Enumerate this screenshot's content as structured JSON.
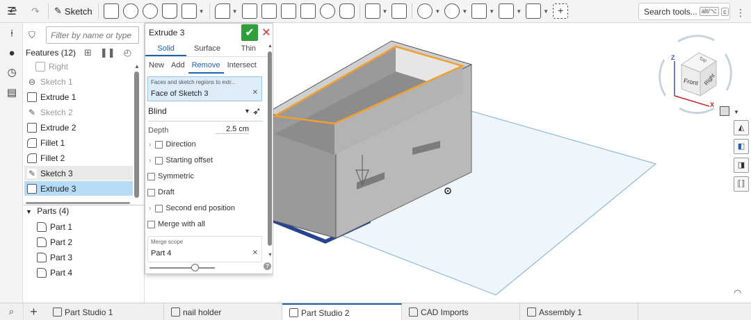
{
  "toolbar": {
    "sketch_label": "Sketch",
    "search_label": "Search tools...",
    "search_kbd1": "alt/⌥",
    "search_kbd2": "c"
  },
  "features": {
    "filter_placeholder": "Filter by name or type",
    "header": "Features (12)",
    "items": [
      {
        "label": "Right"
      },
      {
        "label": "Sketch 1"
      },
      {
        "label": "Extrude 1"
      },
      {
        "label": "Sketch 2"
      },
      {
        "label": "Extrude 2"
      },
      {
        "label": "Fillet 1"
      },
      {
        "label": "Fillet 2"
      },
      {
        "label": "Sketch 3"
      },
      {
        "label": "Extrude 3"
      }
    ],
    "parts_header": "Parts (4)",
    "parts": [
      {
        "label": "Part 1"
      },
      {
        "label": "Part 2"
      },
      {
        "label": "Part 3"
      },
      {
        "label": "Part 4"
      }
    ]
  },
  "dialog": {
    "title": "Extrude 3",
    "tabs1": [
      "Solid",
      "Surface",
      "Thin"
    ],
    "tabs2": [
      "New",
      "Add",
      "Remove",
      "Intersect"
    ],
    "selection_label": "Faces and sketch regions to extr...",
    "selection_value": "Face of Sketch 3",
    "end_type": "Blind",
    "depth_label": "Depth",
    "depth_value": "2.5 cm",
    "direction_label": "Direction",
    "starting_offset_label": "Starting offset",
    "symmetric_label": "Symmetric",
    "draft_label": "Draft",
    "second_end_label": "Second end position",
    "merge_all_label": "Merge with all",
    "merge_scope_label": "Merge scope",
    "merge_scope_value": "Part 4",
    "ok_color": "#2f9e3b",
    "cancel_color": "#cc3333"
  },
  "viewcube": {
    "top": "Top",
    "front": "Front",
    "right": "Right",
    "axis_x": "X",
    "axis_z": "Z"
  },
  "tabs": [
    {
      "label": "Part Studio 1"
    },
    {
      "label": "nail holder"
    },
    {
      "label": "Part Studio 2"
    },
    {
      "label": "CAD Imports"
    },
    {
      "label": "Assembly 1"
    }
  ],
  "colors": {
    "accent": "#1f5fad",
    "selected_row": "#b6dcf5",
    "highlight_edge": "#f0a030"
  }
}
